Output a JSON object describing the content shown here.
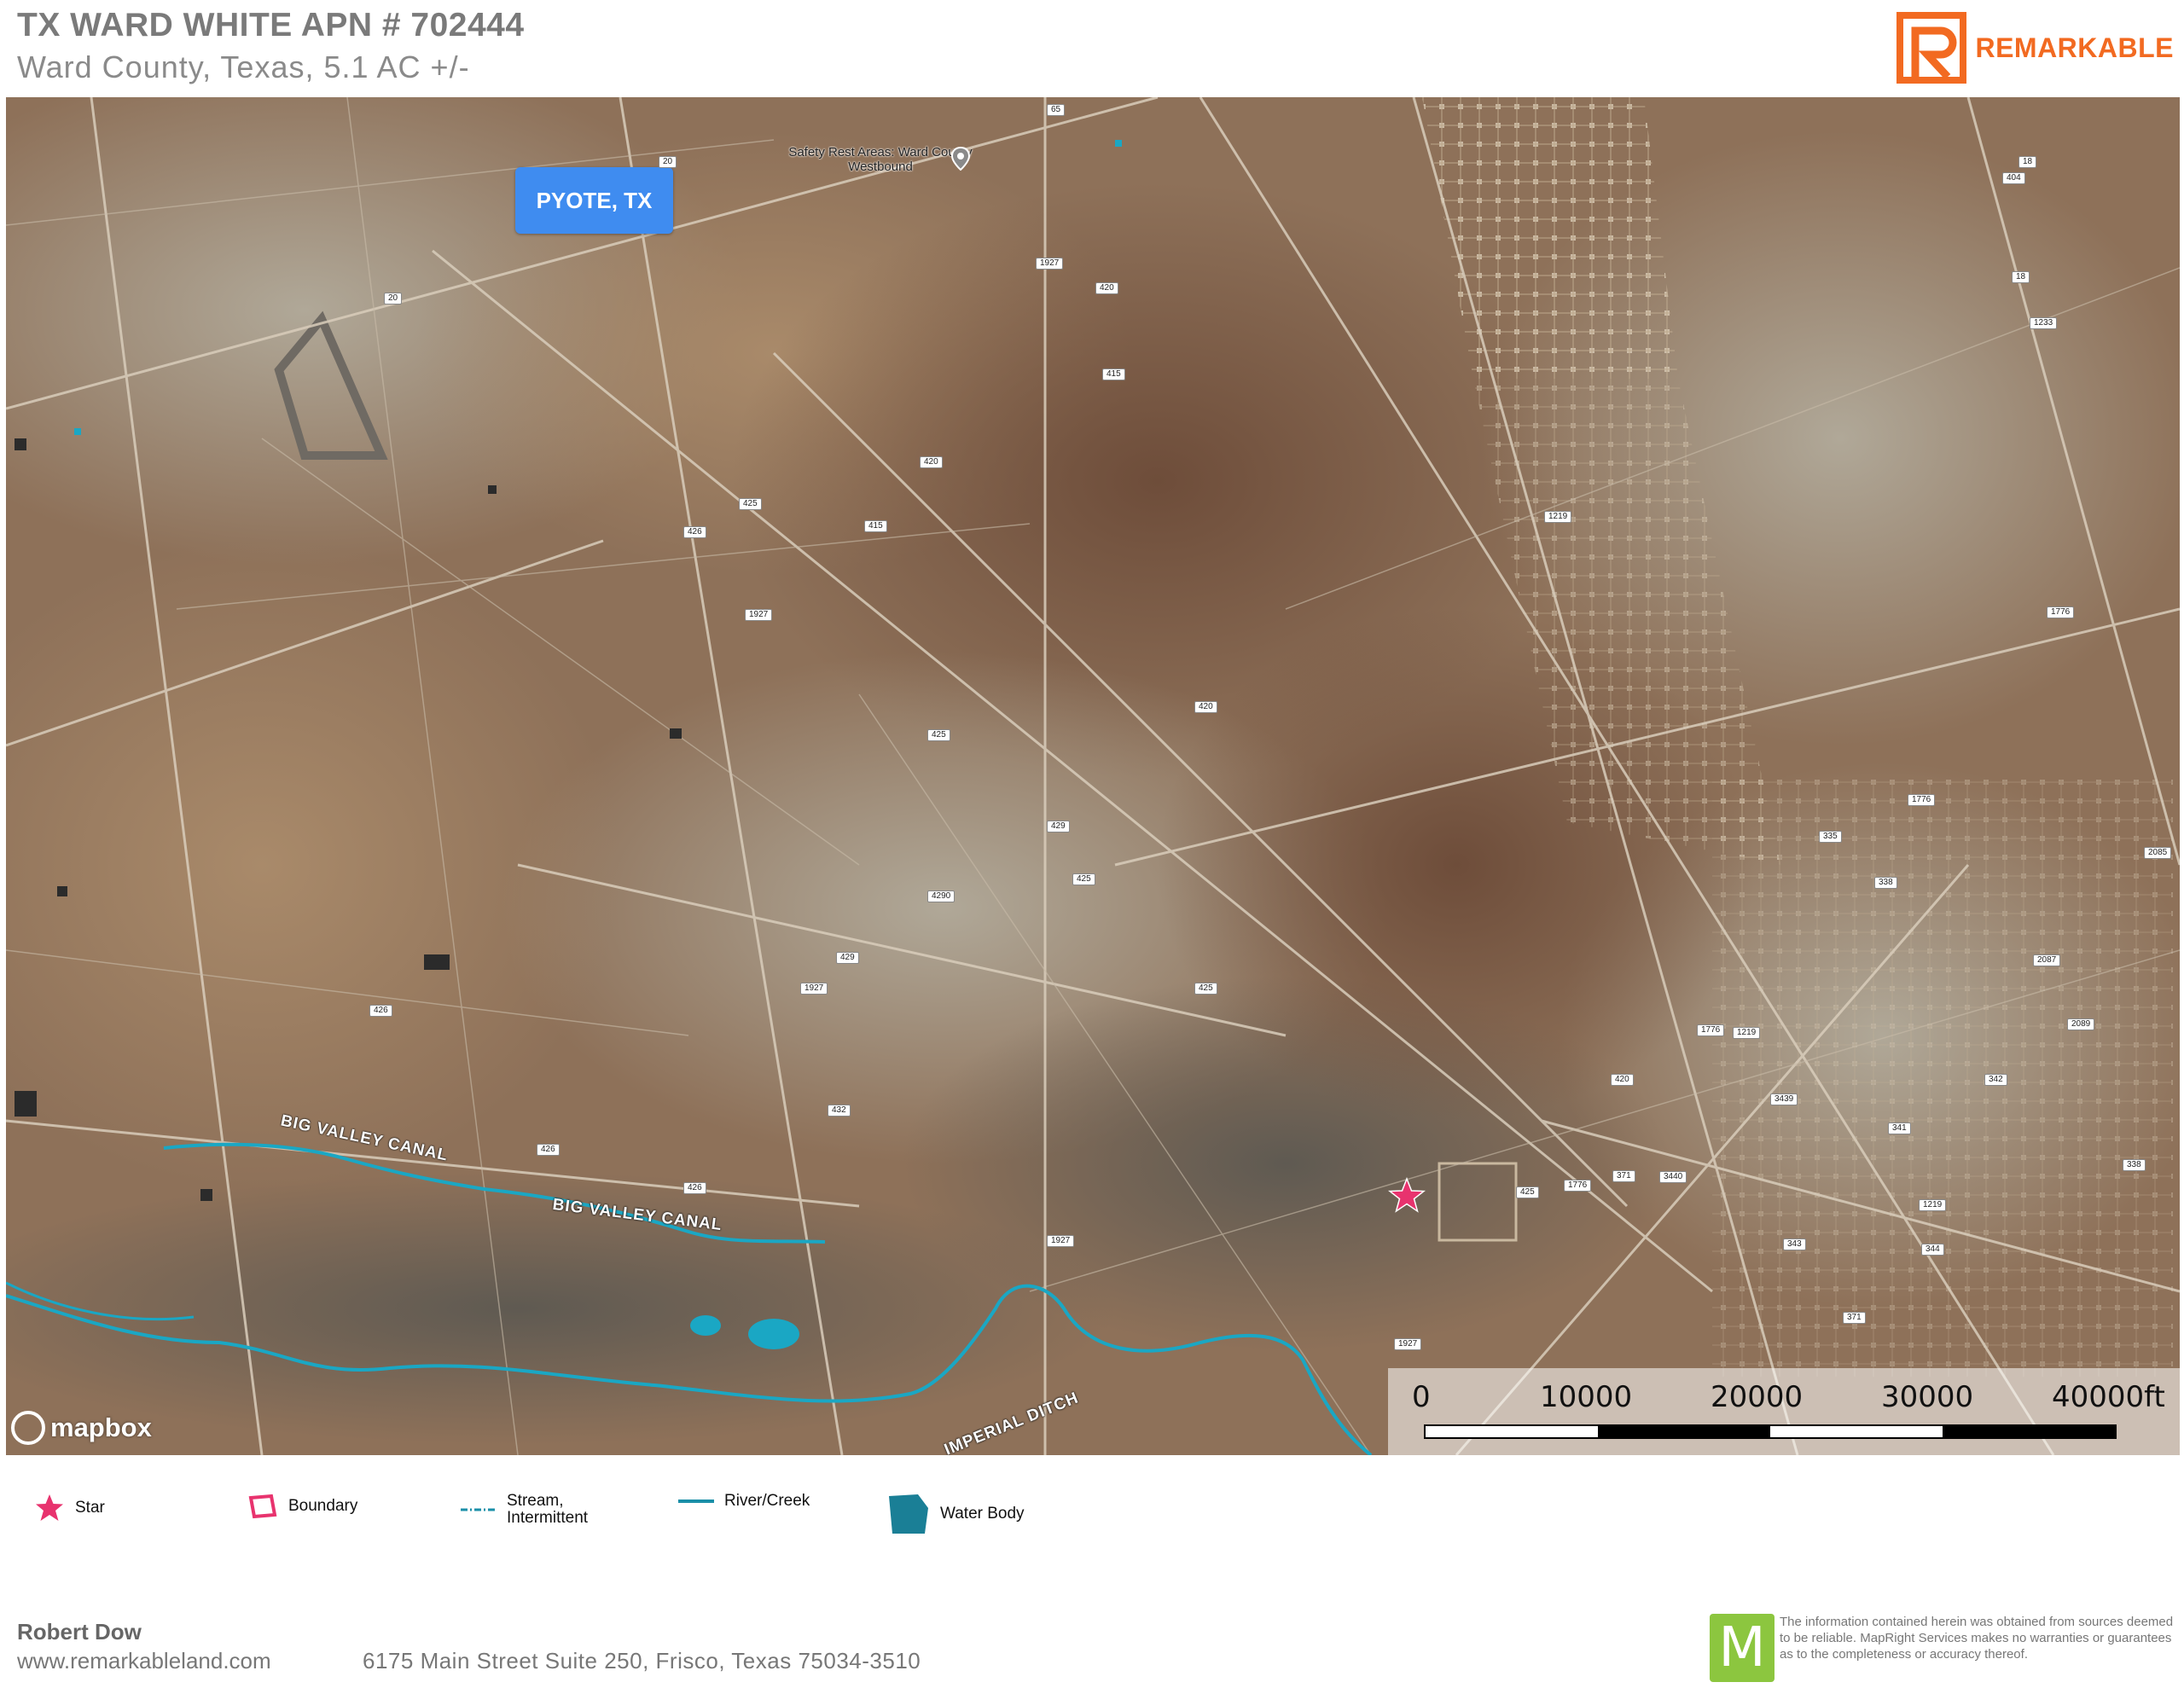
{
  "header": {
    "title": "TX WARD WHITE APN # 702444",
    "subtitle": "Ward County, Texas, 5.1 AC +/-",
    "brand_name": "REMARKABLE",
    "brand_color": "#f26a21"
  },
  "map": {
    "callout_label": "PYOTE, TX",
    "callout_color": "#3f8cf0",
    "poi_label": "Safety Rest Areas: Ward County Westbound",
    "poi_icon": "map-pin-icon",
    "canal_label_1": "BIG VALLEY CANAL",
    "canal_label_2": "BIG VALLEY CANAL",
    "ditch_label": "IMPERIAL DITCH",
    "attribution": "mapbox",
    "marker_icon": "star-icon",
    "marker_color": "#e8336e",
    "water_color": "#1aa7c4",
    "road_shields": [
      "20",
      "20",
      "65",
      "1927",
      "420",
      "415",
      "420",
      "425",
      "426",
      "415",
      "1927",
      "420",
      "425",
      "429",
      "425",
      "4290",
      "429",
      "1927",
      "425",
      "426",
      "432",
      "426",
      "426",
      "1927",
      "1927",
      "1219",
      "18",
      "1233",
      "18",
      "1776",
      "1776",
      "335",
      "338",
      "2085",
      "2087",
      "2089",
      "1776",
      "1219",
      "342",
      "420",
      "3439",
      "341",
      "338",
      "371",
      "3440",
      "425",
      "1776",
      "1219",
      "343",
      "344",
      "371",
      "404"
    ],
    "scale": {
      "ticks": [
        "0",
        "10000",
        "20000",
        "30000",
        "40000ft"
      ]
    }
  },
  "legend": {
    "items": [
      {
        "label": "Star",
        "icon": "star-icon",
        "color": "#e8336e"
      },
      {
        "label": "Boundary",
        "icon": "boundary-icon",
        "color": "#e8336e"
      },
      {
        "label": "Stream,\nIntermittent",
        "label_line1": "Stream,",
        "label_line2": "Intermittent",
        "icon": "stream-intermittent-icon",
        "color": "#1a8fa8"
      },
      {
        "label": "River/Creek",
        "icon": "river-creek-icon",
        "color": "#1a8fa8"
      },
      {
        "label": "Water Body",
        "icon": "water-body-icon",
        "color": "#1a7f96"
      }
    ]
  },
  "footer": {
    "agent_name": "Robert Dow",
    "website": "www.remarkableland.com",
    "address": "6175 Main Street Suite 250, Frisco, Texas 75034-3510",
    "disclaimer": "The information contained herein was obtained from sources deemed to be reliable. MapRight Services makes no warranties or guarantees as to the completeness or accuracy thereof.",
    "mapright_logo_letter": "M",
    "mapright_color": "#8cc63f"
  }
}
